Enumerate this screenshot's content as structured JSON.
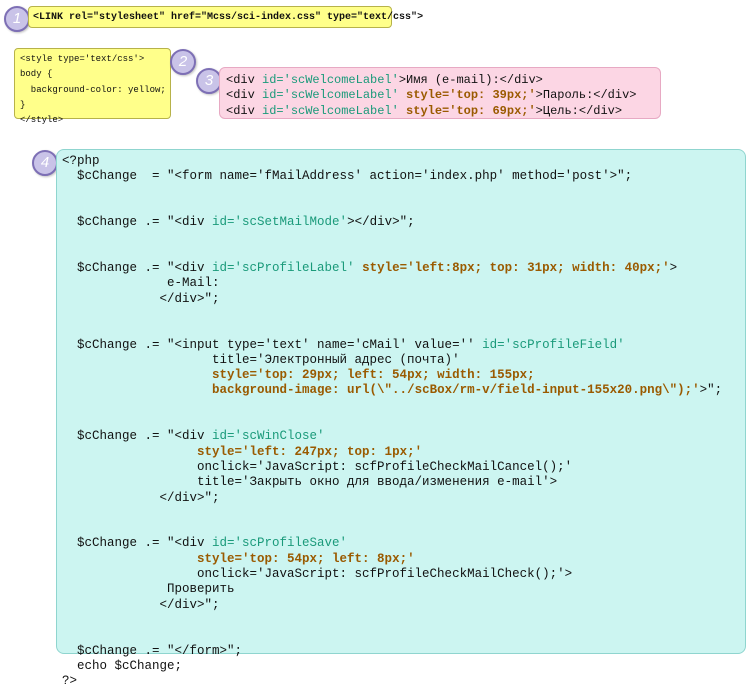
{
  "badges": [
    "1",
    "2",
    "3",
    "4"
  ],
  "box1": {
    "lines": [
      [
        {
          "t": "<LINK rel=\"stylesheet\" href=\"Mcss/sci-index.css\" type=\"text/css\">",
          "c": ""
        }
      ]
    ]
  },
  "box2": {
    "lines": [
      [
        {
          "t": "<style type='text/css'>",
          "c": ""
        }
      ],
      [
        {
          "t": "body {",
          "c": ""
        }
      ],
      [
        {
          "t": "  background-color: yellow;",
          "c": ""
        }
      ],
      [
        {
          "t": "}",
          "c": ""
        }
      ],
      [
        {
          "t": "</style>",
          "c": ""
        }
      ]
    ]
  },
  "box3": {
    "lines": [
      [
        {
          "t": "<div ",
          "c": ""
        },
        {
          "t": "id='scWelcomeLabel'",
          "c": "kw"
        },
        {
          "t": ">Имя (e-mail):</div>",
          "c": ""
        }
      ],
      [
        {
          "t": "<div ",
          "c": ""
        },
        {
          "t": "id='scWelcomeLabel'",
          "c": "kw"
        },
        {
          "t": " ",
          "c": ""
        },
        {
          "t": "style='top: 39px;'",
          "c": "st"
        },
        {
          "t": ">Пароль:</div>",
          "c": ""
        }
      ],
      [
        {
          "t": "<div ",
          "c": ""
        },
        {
          "t": "id='scWelcomeLabel'",
          "c": "kw"
        },
        {
          "t": " ",
          "c": ""
        },
        {
          "t": "style='top: 69px;'",
          "c": "st"
        },
        {
          "t": ">Цель:</div>",
          "c": ""
        }
      ]
    ]
  },
  "box4": {
    "lines": [
      [
        {
          "t": "<?php",
          "c": ""
        }
      ],
      [
        {
          "t": "  $cChange  = \"<form name='fMailAddress' action='index.php' method='post'>\";",
          "c": ""
        }
      ],
      [
        {
          "t": "",
          "c": ""
        }
      ],
      [
        {
          "t": "",
          "c": ""
        }
      ],
      [
        {
          "t": "  $cChange .= \"<div ",
          "c": ""
        },
        {
          "t": "id='scSetMailMode'",
          "c": "kw"
        },
        {
          "t": "></div>\";",
          "c": ""
        }
      ],
      [
        {
          "t": "",
          "c": ""
        }
      ],
      [
        {
          "t": "",
          "c": ""
        }
      ],
      [
        {
          "t": "  $cChange .= \"<div ",
          "c": ""
        },
        {
          "t": "id='scProfileLabel'",
          "c": "kw"
        },
        {
          "t": " ",
          "c": ""
        },
        {
          "t": "style='left:8px; top: 31px; width: 40px;'",
          "c": "st"
        },
        {
          "t": ">",
          "c": ""
        }
      ],
      [
        {
          "t": "              e-Mail:",
          "c": ""
        }
      ],
      [
        {
          "t": "             </div>\";",
          "c": ""
        }
      ],
      [
        {
          "t": "",
          "c": ""
        }
      ],
      [
        {
          "t": "",
          "c": ""
        }
      ],
      [
        {
          "t": "  $cChange .= \"<input type='text' name='cMail' value='' ",
          "c": ""
        },
        {
          "t": "id='scProfileField'",
          "c": "kw"
        }
      ],
      [
        {
          "t": "                    title='Электронный адрес (почта)'",
          "c": ""
        }
      ],
      [
        {
          "t": "                    ",
          "c": ""
        },
        {
          "t": "style='top: 29px; left: 54px; width: 155px;",
          "c": "st"
        }
      ],
      [
        {
          "t": "                    ",
          "c": ""
        },
        {
          "t": "background-image: url(\\\"../scBox/rm-v/field-input-155x20.png\\\");'",
          "c": "st"
        },
        {
          "t": ">\";",
          "c": ""
        }
      ],
      [
        {
          "t": "",
          "c": ""
        }
      ],
      [
        {
          "t": "",
          "c": ""
        }
      ],
      [
        {
          "t": "  $cChange .= \"<div ",
          "c": ""
        },
        {
          "t": "id='scWinClose'",
          "c": "kw"
        }
      ],
      [
        {
          "t": "                  ",
          "c": ""
        },
        {
          "t": "style='left: 247px; top: 1px;'",
          "c": "st"
        }
      ],
      [
        {
          "t": "                  onclick='JavaScript: scfProfileCheckMailCancel();'",
          "c": ""
        }
      ],
      [
        {
          "t": "                  title='Закрыть окно для ввода/изменения e-mail'>",
          "c": ""
        }
      ],
      [
        {
          "t": "             </div>\";",
          "c": ""
        }
      ],
      [
        {
          "t": "",
          "c": ""
        }
      ],
      [
        {
          "t": "",
          "c": ""
        }
      ],
      [
        {
          "t": "  $cChange .= \"<div ",
          "c": ""
        },
        {
          "t": "id='scProfileSave'",
          "c": "kw"
        }
      ],
      [
        {
          "t": "                  ",
          "c": ""
        },
        {
          "t": "style='top: 54px; left: 8px;'",
          "c": "st"
        }
      ],
      [
        {
          "t": "                  onclick='JavaScript: scfProfileCheckMailCheck();'>",
          "c": ""
        }
      ],
      [
        {
          "t": "              Проверить",
          "c": ""
        }
      ],
      [
        {
          "t": "             </div>\";",
          "c": ""
        }
      ],
      [
        {
          "t": "",
          "c": ""
        }
      ],
      [
        {
          "t": "",
          "c": ""
        }
      ],
      [
        {
          "t": "  $cChange .= \"</form>\";",
          "c": ""
        }
      ],
      [
        {
          "t": "  echo $cChange;",
          "c": ""
        }
      ],
      [
        {
          "t": "?>",
          "c": ""
        }
      ]
    ]
  },
  "colors": {
    "badge_fill": "#c9c3e8",
    "badge_border": "#7d6fb5",
    "yellow_box": "#ffff8a",
    "pink_box": "#fcd6e4",
    "cyan_box": "#ccf5f1",
    "id_text": "#1a9a7a",
    "style_text": "#9a5a00"
  }
}
